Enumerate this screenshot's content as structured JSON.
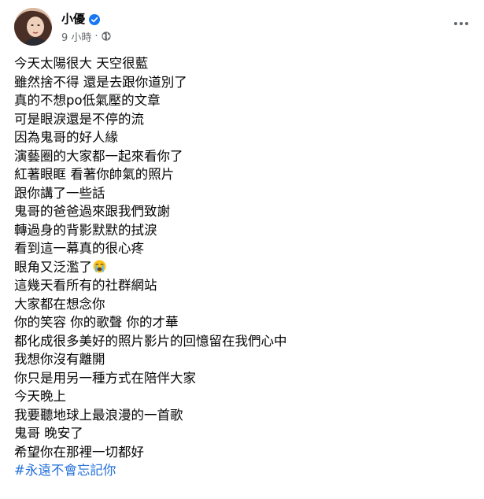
{
  "author": {
    "name": "小優",
    "verified": true
  },
  "meta": {
    "time": "9 小時",
    "separator": "·",
    "audience_icon": "globe-icon"
  },
  "more_icon": "more-options-icon",
  "post": {
    "lines": [
      "今天太陽很大 天空很藍",
      "雖然捨不得 還是去跟你道別了",
      "真的不想po低氣壓的文章",
      "可是眼淚還是不停的流",
      "因為鬼哥的好人緣",
      "演藝圈的大家都一起來看你了",
      "紅著眼眶 看著你帥氣的照片",
      "跟你講了一些話",
      "鬼哥的爸爸過來跟我們致謝",
      "轉過身的背影默默的拭淚",
      "看到這一幕真的很心疼",
      "眼角又泛濫了",
      "這幾天看所有的社群網站",
      "大家都在想念你",
      "你的笑容 你的歌聲 你的才華",
      "都化成很多美好的照片影片的回憶留在我們心中",
      "我想你沒有離開",
      "你只是用另一種方式在陪伴大家",
      "今天晚上",
      "我要聽地球上最浪漫的一首歌",
      "鬼哥 晚安了",
      "希望你在那裡一切都好"
    ],
    "emoji": "crying-face-emoji",
    "hashtag": "#永遠不會忘記你"
  },
  "colors": {
    "text": "#050505",
    "meta": "#65676b",
    "verified": "#1877f2",
    "hashtag": "#216fdb"
  }
}
